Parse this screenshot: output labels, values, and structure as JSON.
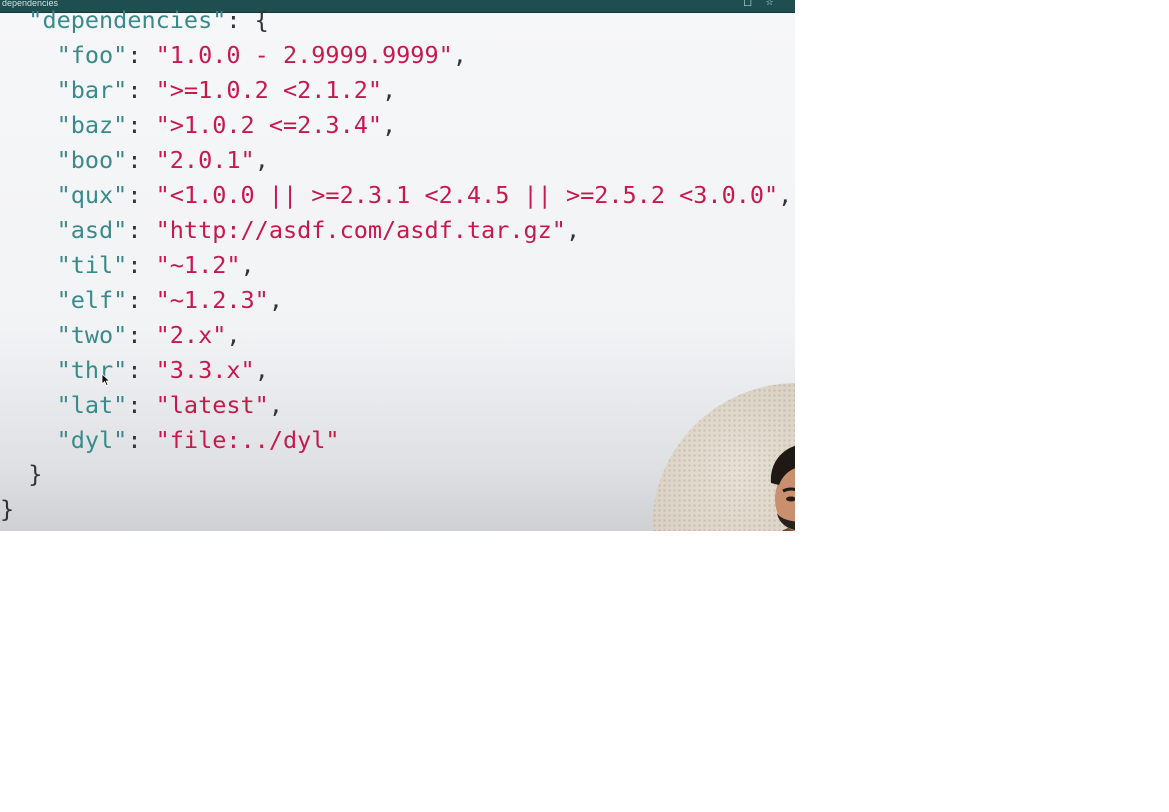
{
  "window": {
    "title": "dependencies"
  },
  "editor": {
    "lines": [
      {
        "indent": "  ",
        "key": "\"dependencies\"",
        "sep": ": ",
        "value": "",
        "tail": "{"
      },
      {
        "indent": "    ",
        "key": "\"foo\"",
        "sep": ": ",
        "value": "\"1.0.0 - 2.9999.9999\"",
        "tail": ","
      },
      {
        "indent": "    ",
        "key": "\"bar\"",
        "sep": ": ",
        "value": "\">=1.0.2 <2.1.2\"",
        "tail": ","
      },
      {
        "indent": "    ",
        "key": "\"baz\"",
        "sep": ": ",
        "value": "\">1.0.2 <=2.3.4\"",
        "tail": ","
      },
      {
        "indent": "    ",
        "key": "\"boo\"",
        "sep": ": ",
        "value": "\"2.0.1\"",
        "tail": ","
      },
      {
        "indent": "    ",
        "key": "\"qux\"",
        "sep": ": ",
        "value": "\"<1.0.0 || >=2.3.1 <2.4.5 || >=2.5.2 <3.0.0\"",
        "tail": ","
      },
      {
        "indent": "    ",
        "key": "\"asd\"",
        "sep": ": ",
        "value": "\"http://asdf.com/asdf.tar.gz\"",
        "tail": ","
      },
      {
        "indent": "    ",
        "key": "\"til\"",
        "sep": ": ",
        "value": "\"~1.2\"",
        "tail": ","
      },
      {
        "indent": "    ",
        "key": "\"elf\"",
        "sep": ": ",
        "value": "\"~1.2.3\"",
        "tail": ","
      },
      {
        "indent": "    ",
        "key": "\"two\"",
        "sep": ": ",
        "value": "\"2.x\"",
        "tail": ","
      },
      {
        "indent": "    ",
        "key": "\"thr\"",
        "sep": ": ",
        "value": "\"3.3.x\"",
        "tail": ","
      },
      {
        "indent": "    ",
        "key": "\"lat\"",
        "sep": ": ",
        "value": "\"latest\"",
        "tail": ","
      },
      {
        "indent": "    ",
        "key": "\"dyl\"",
        "sep": ": ",
        "value": "\"file:../dyl\"",
        "tail": ""
      },
      {
        "indent": "  ",
        "key": "",
        "sep": "",
        "value": "",
        "tail": "}"
      },
      {
        "indent": "",
        "key": "",
        "sep": "",
        "value": "",
        "tail": "}"
      }
    ]
  },
  "icons": {
    "copy": "copy-icon",
    "pin": "pin-icon",
    "cursor": "mouse-pointer-icon"
  },
  "colors": {
    "key": "#3a8a8c",
    "string": "#c8194d",
    "punctuation": "#2f3437",
    "topbar": "#1e4e4f"
  }
}
